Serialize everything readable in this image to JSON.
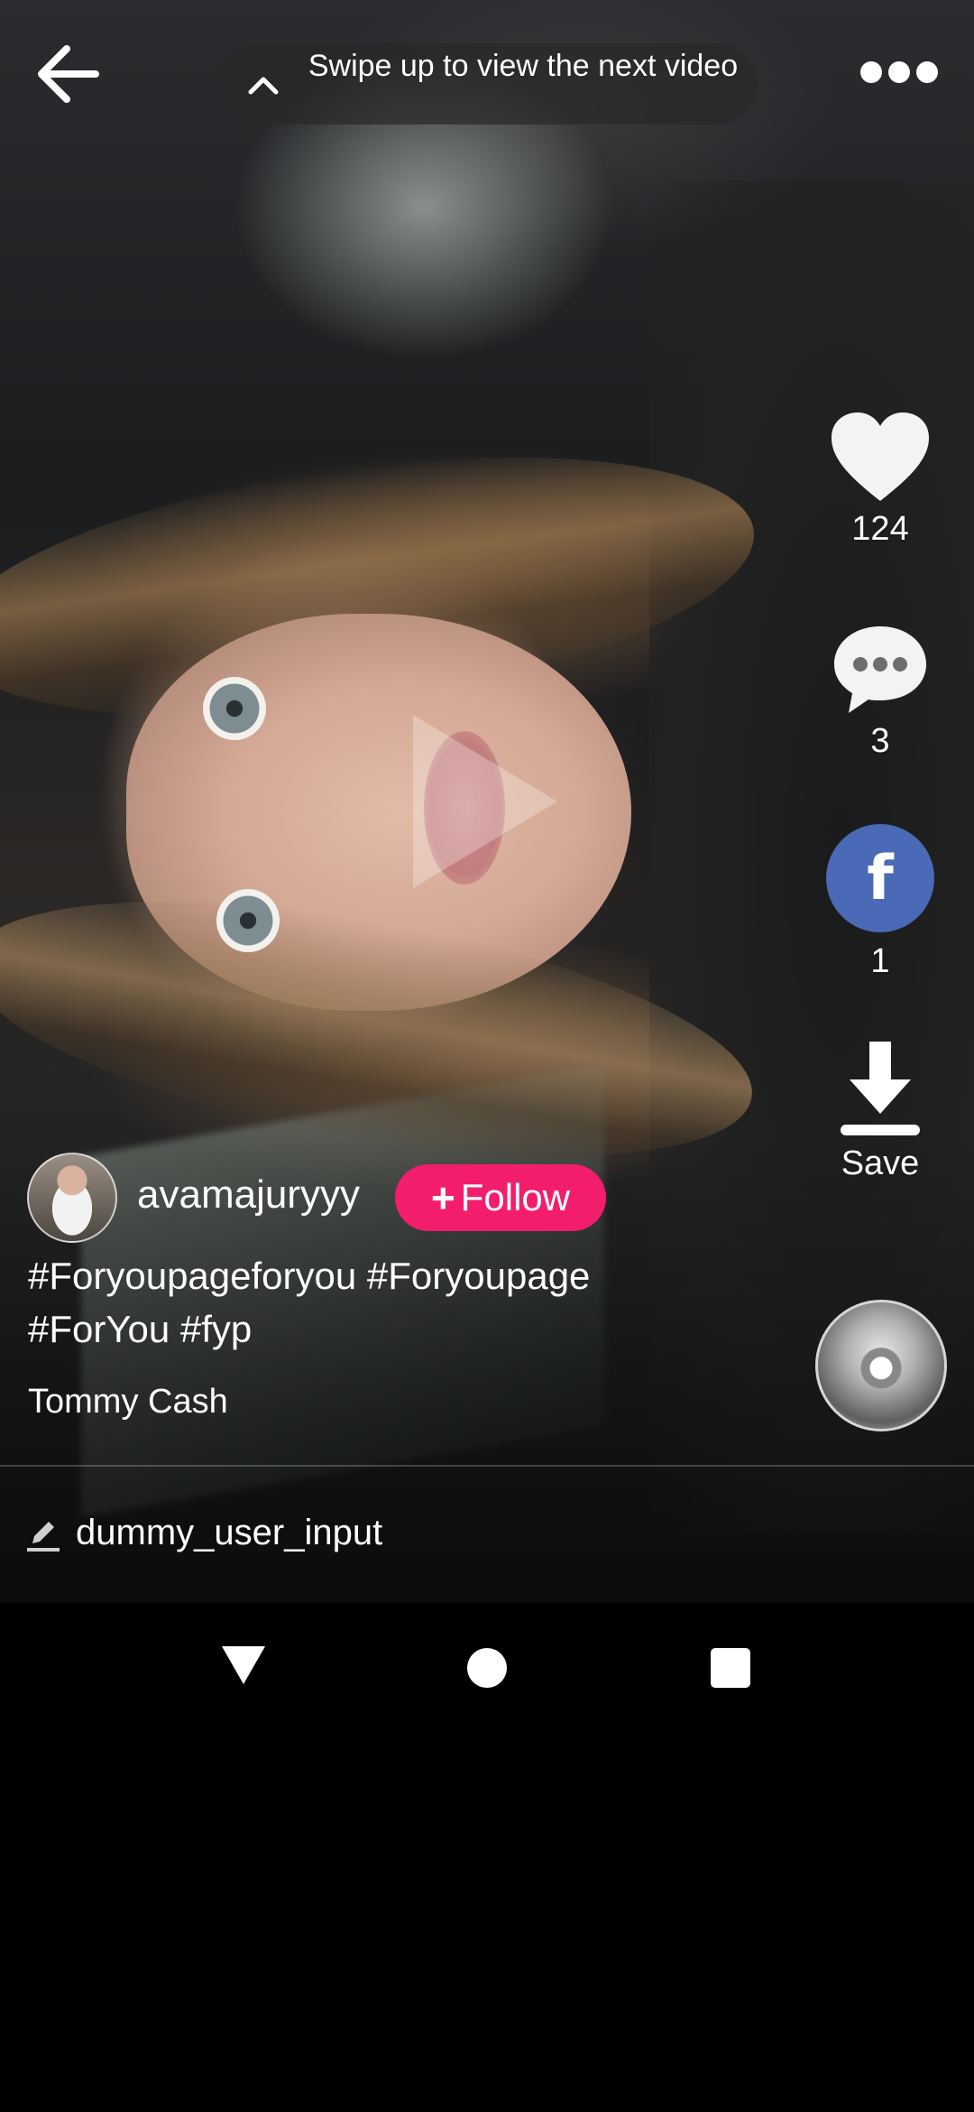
{
  "top_bar": {
    "back_icon": "arrow-left-icon",
    "swipe_hint_icon": "chevron-up-icon",
    "swipe_hint": "Swipe up to view the next video",
    "more_icon": "more-horizontal-icon"
  },
  "video": {
    "play_icon": "play-icon"
  },
  "actions": {
    "like": {
      "icon": "heart-icon",
      "count": "124"
    },
    "comment": {
      "icon": "comment-bubble-icon",
      "count": "3"
    },
    "facebook": {
      "icon": "facebook-icon",
      "glyph": "f",
      "count": "1",
      "color": "#4a69b6"
    },
    "save": {
      "icon": "download-icon",
      "label": "Save"
    },
    "music_disc_icon": "music-disc-icon"
  },
  "author": {
    "username": "avamajuryyy",
    "follow_label": "Follow",
    "follow_plus": "+",
    "follow_color": "#f21e6d"
  },
  "caption": {
    "hashtags": "#Foryoupageforyou #Foryoupage #ForYou #fyp"
  },
  "music": {
    "song": "Tommy Cash"
  },
  "comment_bar": {
    "icon": "pencil-icon",
    "value": "dummy_user_input"
  },
  "system_nav": {
    "back_icon": "nav-back-icon",
    "home_icon": "nav-home-icon",
    "recents_icon": "nav-recents-icon"
  }
}
